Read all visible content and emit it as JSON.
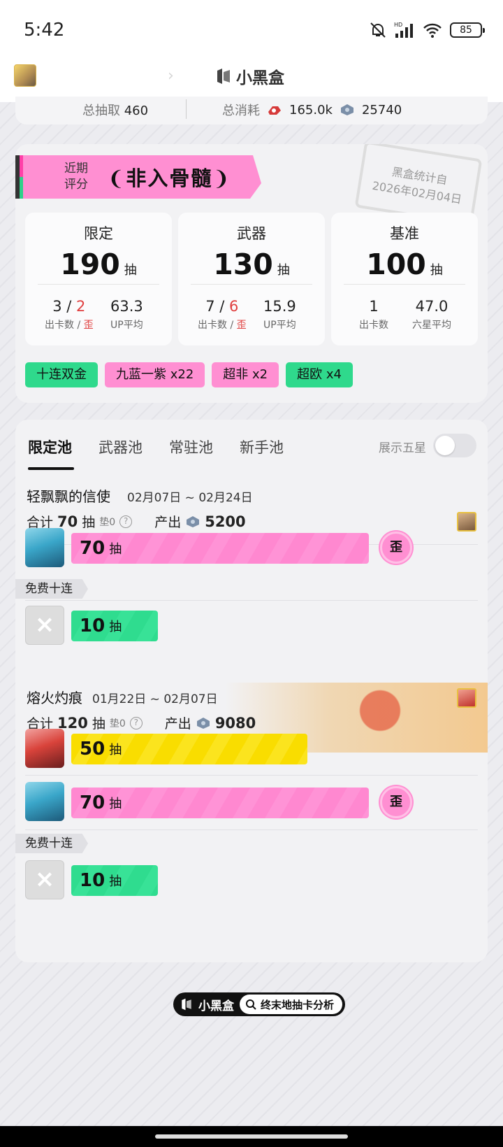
{
  "status_bar": {
    "time": "5:42",
    "battery": "85"
  },
  "header": {
    "brand": "小黑盒"
  },
  "summary": {
    "total_pulls_label": "总抽取",
    "total_pulls": "460",
    "consume_label": "总消耗",
    "consume_a": "165.0k",
    "consume_b": "25740"
  },
  "rating": {
    "label_line1": "近期",
    "label_line2": "评分",
    "title": "非入骨髓",
    "stamp_line1": "黑盒统计自",
    "stamp_line2": "2026年02月04日",
    "stats": [
      {
        "title": "限定",
        "pulls": "190",
        "unit": "抽",
        "left_a": "3",
        "left_sep": " / ",
        "left_b": "2",
        "left_label_a": "出卡数 / ",
        "left_label_b": "歪",
        "right_val": "63.3",
        "right_label": "UP平均"
      },
      {
        "title": "武器",
        "pulls": "130",
        "unit": "抽",
        "left_a": "7",
        "left_sep": " / ",
        "left_b": "6",
        "left_label_a": "出卡数 / ",
        "left_label_b": "歪",
        "right_val": "15.9",
        "right_label": "UP平均"
      },
      {
        "title": "基准",
        "pulls": "100",
        "unit": "抽",
        "left_a": "1",
        "left_label_a": "出卡数",
        "right_val": "47.0",
        "right_label": "六星平均"
      }
    ],
    "tags": [
      {
        "text": "十连双金",
        "color": "green"
      },
      {
        "text": "九蓝一紫 x22",
        "color": "pink"
      },
      {
        "text": "超非 x2",
        "color": "pink"
      },
      {
        "text": "超欧 x4",
        "color": "green"
      }
    ]
  },
  "pools": {
    "tabs": [
      "限定池",
      "武器池",
      "常驻池",
      "新手池"
    ],
    "toggle_label": "展示五星",
    "banner1": {
      "name": "轻飘飘的信使",
      "date": "02月07日 ~ 02月24日",
      "total_label": "合计",
      "total": "70",
      "unit": "抽",
      "pity": "垫0",
      "produce_label": "产出",
      "produce": "5200",
      "rows": [
        {
          "pulls": "70",
          "unit": "抽",
          "wai": "歪"
        }
      ],
      "free_label": "免费十连",
      "free_pulls": "10",
      "free_unit": "抽"
    },
    "banner2": {
      "name": "熔火灼痕",
      "date": "01月22日 ~ 02月07日",
      "total_label": "合计",
      "total": "120",
      "unit": "抽",
      "pity": "垫0",
      "produce_label": "产出",
      "produce": "9080",
      "rows": [
        {
          "pulls": "50",
          "unit": "抽"
        },
        {
          "pulls": "70",
          "unit": "抽",
          "wai": "歪"
        }
      ],
      "free_label": "免费十连",
      "free_pulls": "10",
      "free_unit": "抽"
    }
  },
  "footer": {
    "brand": "小黑盒",
    "search": "终末地抽卡分析"
  }
}
